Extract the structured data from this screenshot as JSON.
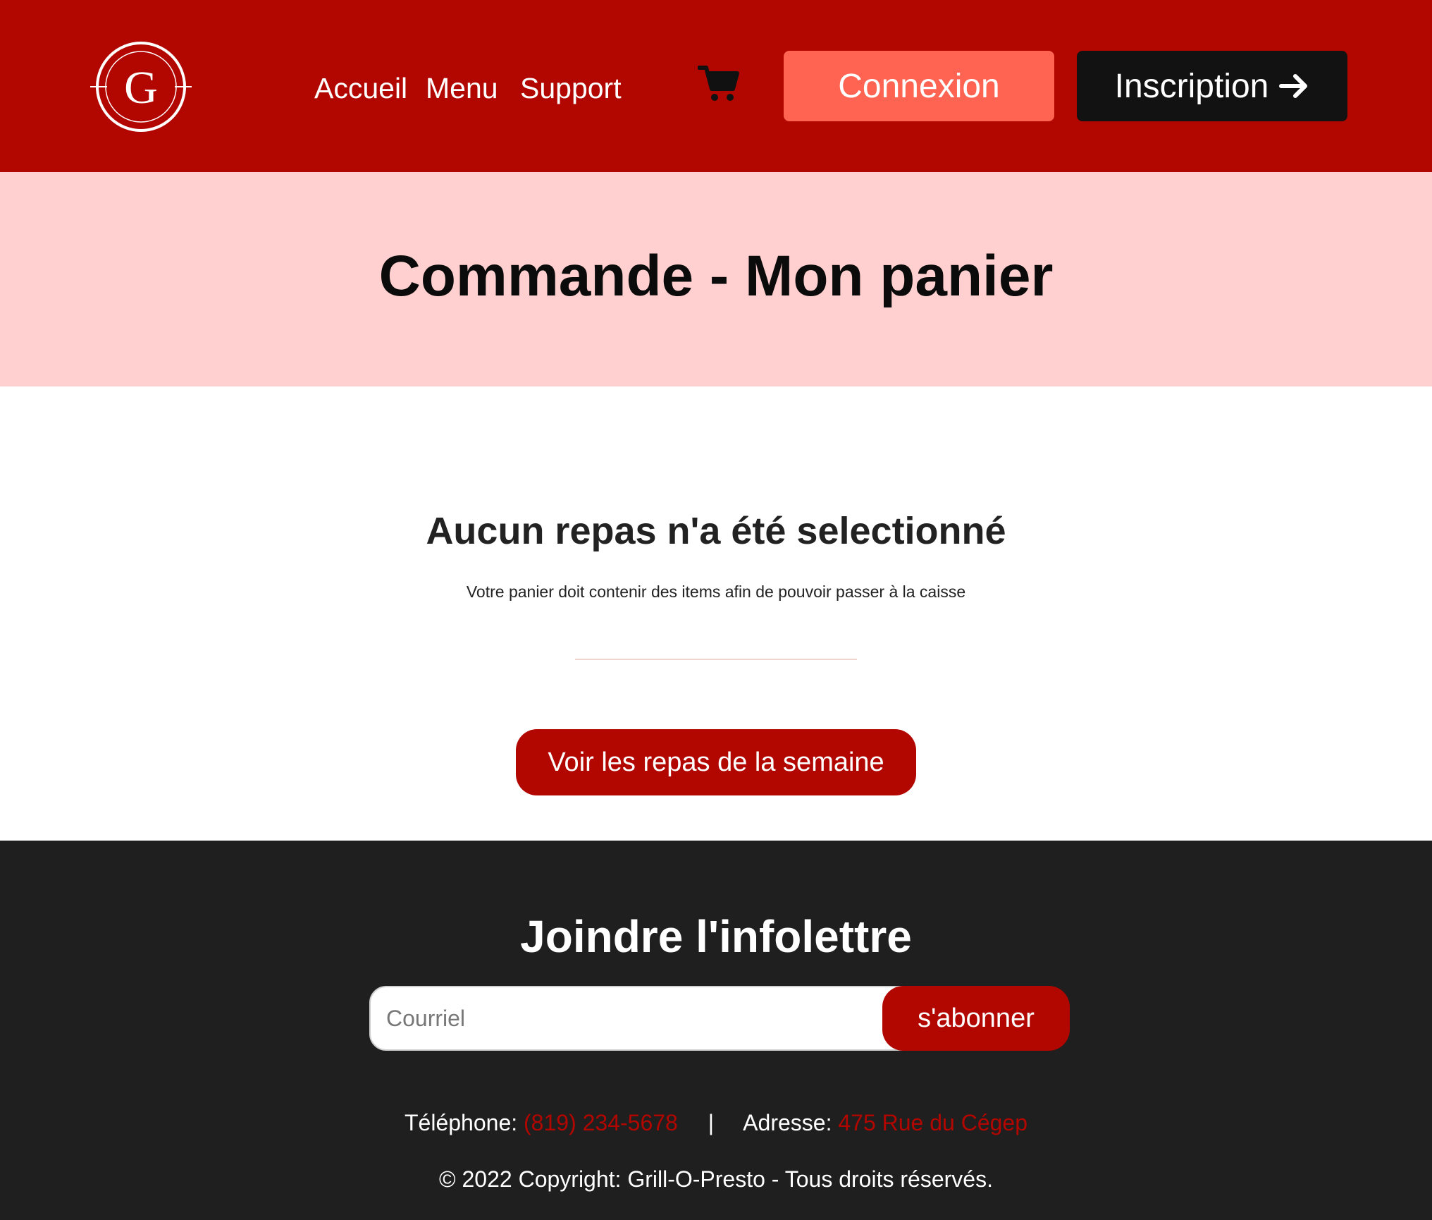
{
  "header": {
    "logo_letter": "G",
    "nav": [
      "Accueil",
      "Menu",
      "Support"
    ],
    "cart_icon": "shopping-cart-icon",
    "login_label": "Connexion",
    "signup_label": "Inscription",
    "signup_icon": "arrow-right-icon"
  },
  "hero": {
    "title": "Commande - Mon panier"
  },
  "cart": {
    "empty_heading": "Aucun repas n'a été selectionné",
    "empty_message": "Votre panier doit contenir des items afin de pouvoir passer à la caisse",
    "view_meals_label": "Voir les repas de la semaine"
  },
  "footer": {
    "newsletter_title": "Joindre l'infolettre",
    "email_placeholder": "Courriel",
    "subscribe_label": "s'abonner",
    "phone_label": "Téléphone:",
    "phone_value": "(819) 234-5678",
    "separator": "|",
    "address_label": "Adresse:",
    "address_value": "475 Rue du Cégep",
    "copyright": "© 2022 Copyright: Grill-O-Presto - Tous droits réservés."
  },
  "colors": {
    "brand_red": "#b20600",
    "login_coral": "#ff6351",
    "title_band": "#ffd0cf",
    "footer_bg": "#1f1f1f"
  }
}
